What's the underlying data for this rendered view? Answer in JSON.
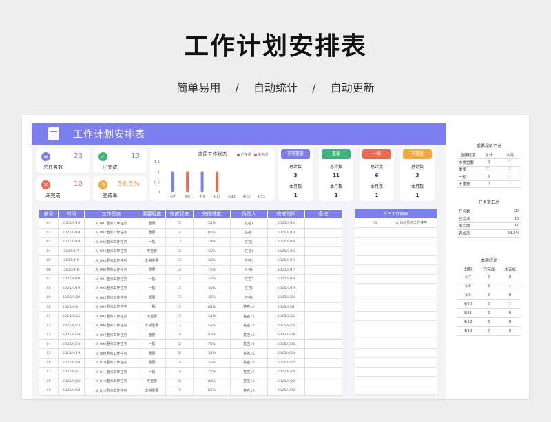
{
  "header": {
    "title": "工作计划安排表",
    "features": [
      "简单易用",
      "自动统计",
      "自动更新"
    ],
    "separator": "/"
  },
  "banner": {
    "title": "工作计划安排表"
  },
  "stats": [
    {
      "label": "总任务数",
      "value": "23",
      "color": "#7b7ff0",
      "icon": "clipboard-icon"
    },
    {
      "label": "已完成",
      "value": "13",
      "color": "#3cb57a",
      "icon": "check-icon"
    },
    {
      "label": "未完成",
      "value": "10",
      "color": "#ea6a4f",
      "icon": "x-icon"
    },
    {
      "label": "完成率",
      "value": "56.5%",
      "color": "#f3a93b",
      "icon": "pie-icon"
    }
  ],
  "chart_data": {
    "type": "bar",
    "title": "本周工作状态",
    "categories": [
      "4/7",
      "4/8",
      "4/9",
      "4/10",
      "4/11",
      "4/12",
      "4/13"
    ],
    "series": [
      {
        "name": "已完成",
        "values": [
          1,
          0,
          1,
          0,
          0,
          0,
          0
        ],
        "color": "#7b7ff0"
      },
      {
        "name": "未完成",
        "values": [
          0,
          1,
          0,
          1,
          0,
          0,
          0
        ],
        "color": "#ea6a4f"
      }
    ],
    "yticks": [
      "0",
      "0.5",
      "1",
      "1.5"
    ],
    "ylim": [
      0,
      1.5
    ]
  },
  "importance": [
    {
      "name": "非常重要",
      "color": "#7b7ff0",
      "total_label": "总计数",
      "total": "3",
      "month_label": "本月数",
      "month": "1"
    },
    {
      "name": "重要",
      "color": "#3cb57a",
      "total_label": "总计数",
      "total": "11",
      "month_label": "本月数",
      "month": "1"
    },
    {
      "name": "一般",
      "color": "#ea6a4f",
      "total_label": "总计数",
      "total": "6",
      "month_label": "本月数",
      "month": "1"
    },
    {
      "name": "不重要",
      "color": "#f3a93b",
      "total_label": "总计数",
      "total": "3",
      "month_label": "本月数",
      "month": "1"
    }
  ],
  "table": {
    "headers": [
      "序号",
      "时间",
      "工作任务",
      "重要程度",
      "完成状态",
      "完成进度",
      "负责人",
      "完成时间",
      "备注"
    ],
    "rows": [
      [
        "01",
        "2025/9/18",
        "A_001重点工作任务",
        "重要",
        "☐",
        "25%",
        "姓名1",
        "2025/9/12",
        ""
      ],
      [
        "02",
        "2025/9/18",
        "A_002重点工作任务",
        "重要",
        "☑",
        "85%",
        "姓名2",
        "2025/9/13",
        ""
      ],
      [
        "03",
        "2025/9/18",
        "A_003重点工作任务",
        "一般",
        "☐",
        "18%",
        "姓名3",
        "2025/9/14",
        ""
      ],
      [
        "04",
        "2025/4/7",
        "A_004重点工作任务",
        "不重要",
        "☑",
        "55%",
        "姓名4",
        "2025/9/15",
        ""
      ],
      [
        "05",
        "2025/4/8",
        "A_005重点工作任务",
        "非常重要",
        "☐",
        "25%",
        "姓名5",
        "2025/9/16",
        ""
      ],
      [
        "06",
        "2025/4/9",
        "A_006重点工作任务",
        "重要",
        "☑",
        "75%",
        "姓名6",
        "2025/9/17",
        ""
      ],
      [
        "07",
        "2025/4/10",
        "B_001重点工作任务",
        "一般",
        "☐",
        "55%",
        "姓名7",
        "2025/9/18",
        ""
      ],
      [
        "08",
        "2025/9/19",
        "B_002重点工作任务",
        "一般",
        "☐",
        "35%",
        "姓名8",
        "2025/9/19",
        ""
      ],
      [
        "09",
        "2025/9/20",
        "B_003重点工作任务",
        "重要",
        "☐",
        "25%",
        "姓名9",
        "2025/9/20",
        ""
      ],
      [
        "10",
        "2025/9/21",
        "B_004重点工作任务",
        "一般",
        "☐",
        "65%",
        "姓名10",
        "2025/9/21",
        ""
      ],
      [
        "11",
        "2025/9/22",
        "B_005重点工作任务",
        "不重要",
        "☐",
        "25%",
        "姓名11",
        "2025/9/22",
        ""
      ],
      [
        "12",
        "2025/9/23",
        "B_006重点工作任务",
        "非常重要",
        "☐",
        "55%",
        "姓名12",
        "2025/9/23",
        ""
      ],
      [
        "13",
        "2025/9/24",
        "B_007重点工作任务",
        "重要",
        "☑",
        "85%",
        "姓名13",
        "2025/9/24",
        ""
      ],
      [
        "14",
        "2025/9/24",
        "B_008重点工作任务",
        "一般",
        "☑",
        "75%",
        "姓名14",
        "2025/9/25",
        ""
      ],
      [
        "15",
        "2025/9/19",
        "B_009重点工作任务",
        "重要",
        "☑",
        "35%",
        "姓名15",
        "2025/9/26",
        ""
      ],
      [
        "16",
        "2025/9/20",
        "B_010重点工作任务",
        "重要",
        "☑",
        "55%",
        "姓名16",
        "2025/9/27",
        ""
      ],
      [
        "17",
        "2025/9/21",
        "B_011重点工作任务",
        "一般",
        "☑",
        "25%",
        "姓名17",
        "2025/9/28",
        ""
      ],
      [
        "18",
        "2025/9/22",
        "B_012重点工作任务",
        "不重要",
        "☑",
        "85%",
        "姓名18",
        "2025/9/29",
        ""
      ],
      [
        "19",
        "2025/9/23",
        "B_013重点工作任务",
        "非常重要",
        "☐",
        "65%",
        "姓名19",
        "2025/9/30",
        ""
      ]
    ]
  },
  "today": {
    "title": "今日工作列表",
    "items": [
      {
        "check": "☑",
        "task": "A_006重点工作任务"
      }
    ]
  },
  "importance_summary": {
    "title": "重要程度汇总",
    "headers": [
      "重要程度",
      "总计",
      "本月"
    ],
    "rows": [
      [
        "非常重要",
        "3",
        "1"
      ],
      [
        "重要",
        "11",
        "1"
      ],
      [
        "一般",
        "6",
        "1"
      ],
      [
        "不重要",
        "3",
        "1"
      ]
    ]
  },
  "task_summary": {
    "title": "任务数汇总",
    "rows": [
      [
        "任务数",
        "23"
      ],
      [
        "已完成",
        "13"
      ],
      [
        "未完成",
        "10"
      ],
      [
        "完成率",
        "56.5%"
      ]
    ]
  },
  "week_stats": {
    "title": "本周统计",
    "headers": [
      "日期",
      "已完成",
      "未完成"
    ],
    "rows": [
      [
        "4/7",
        "1",
        "0"
      ],
      [
        "4/8",
        "0",
        "1"
      ],
      [
        "4/9",
        "1",
        "0"
      ],
      [
        "4/10",
        "0",
        "1"
      ],
      [
        "4/11",
        "0",
        "0"
      ],
      [
        "4/12",
        "0",
        "0"
      ],
      [
        "4/13",
        "0",
        "0"
      ]
    ]
  }
}
